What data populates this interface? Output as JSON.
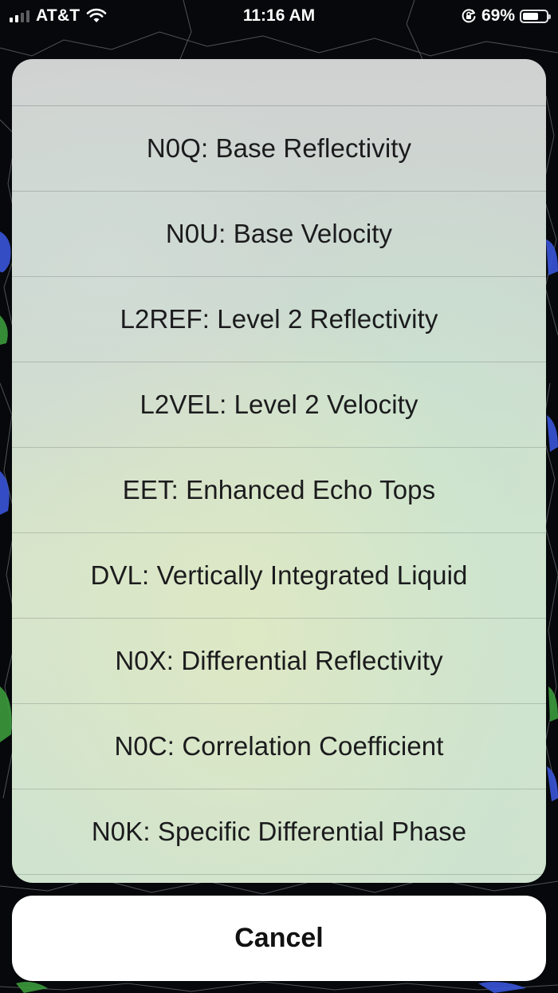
{
  "status_bar": {
    "carrier": "AT&T",
    "time": "11:16 AM",
    "battery_percent": "69%",
    "battery_level": 0.69,
    "icons": [
      "signal-icon",
      "wifi-icon",
      "orientation-lock-icon",
      "battery-icon"
    ]
  },
  "action_sheet": {
    "options": [
      "N0Q: Base Reflectivity",
      "N0U: Base Velocity",
      "L2REF: Level 2 Reflectivity",
      "L2VEL: Level 2 Velocity",
      "EET: Enhanced Echo Tops",
      "DVL: Vertically Integrated Liquid",
      "N0X: Differential Reflectivity",
      "N0C: Correlation Coefficient",
      "N0K: Specific Differential Phase"
    ],
    "cancel_label": "Cancel"
  },
  "colors": {
    "map_background": "#07090c",
    "radar_green": "#3c9a3c",
    "radar_blue": "#3a55d8",
    "cancel_background": "#ffffff"
  }
}
